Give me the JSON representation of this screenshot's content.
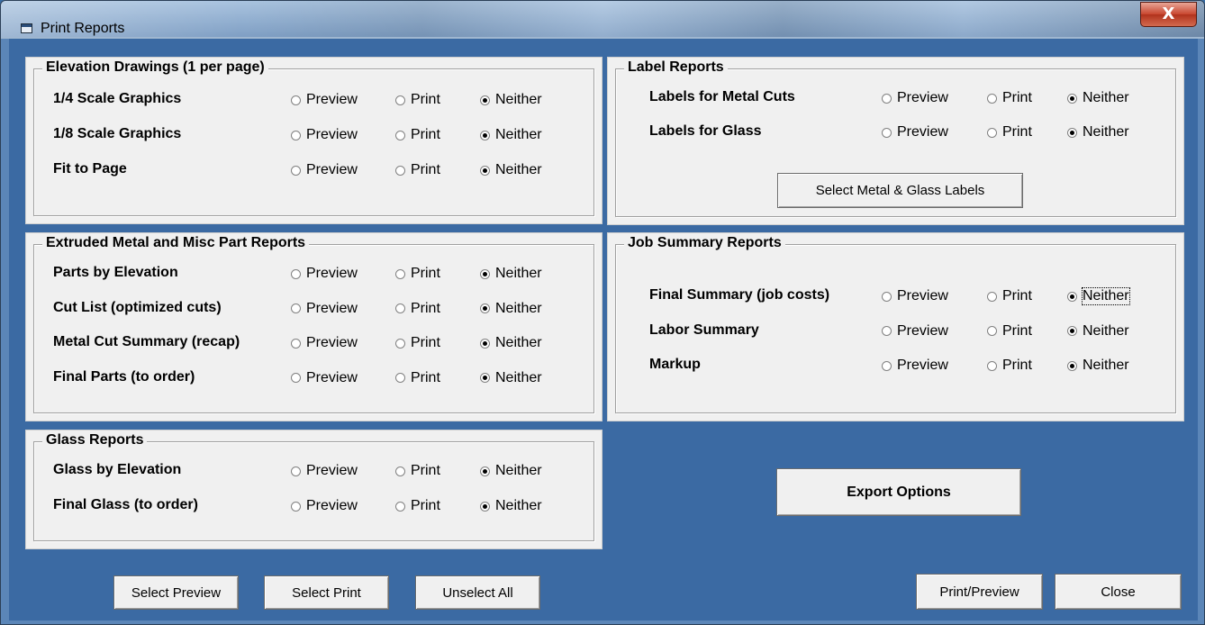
{
  "window": {
    "title": "Print Reports",
    "close_glyph": "X",
    "close_icon": "close-icon",
    "app_icon": "report-window-icon"
  },
  "options": {
    "preview": "Preview",
    "print": "Print",
    "neither": "Neither"
  },
  "groups": {
    "elevation": {
      "title": "Elevation Drawings (1 per page)",
      "rows": [
        {
          "label": "1/4 Scale Graphics",
          "selected": "neither"
        },
        {
          "label": "1/8 Scale Graphics",
          "selected": "neither"
        },
        {
          "label": "Fit to Page",
          "selected": "neither"
        }
      ]
    },
    "extruded": {
      "title": "Extruded Metal and Misc Part Reports",
      "rows": [
        {
          "label": "Parts by Elevation",
          "selected": "neither"
        },
        {
          "label": "Cut List (optimized cuts)",
          "selected": "neither"
        },
        {
          "label": "Metal Cut Summary (recap)",
          "selected": "neither"
        },
        {
          "label": "Final Parts (to order)",
          "selected": "neither"
        }
      ]
    },
    "glass": {
      "title": "Glass Reports",
      "rows": [
        {
          "label": "Glass by Elevation",
          "selected": "neither"
        },
        {
          "label": "Final Glass (to order)",
          "selected": "neither"
        }
      ]
    },
    "label": {
      "title": "Label Reports",
      "rows": [
        {
          "label": "Labels for Metal Cuts",
          "selected": "neither"
        },
        {
          "label": "Labels for Glass",
          "selected": "neither"
        }
      ],
      "button": "Select Metal & Glass Labels"
    },
    "job": {
      "title": "Job Summary Reports",
      "rows": [
        {
          "label": "Final Summary (job costs)",
          "selected": "neither"
        },
        {
          "label": "Labor Summary",
          "selected": "neither"
        },
        {
          "label": "Markup",
          "selected": "neither"
        }
      ]
    }
  },
  "buttons": {
    "export": "Export Options",
    "select_preview": "Select Preview",
    "select_print": "Select Print",
    "unselect_all": "Unselect All",
    "print_preview": "Print/Preview",
    "close": "Close"
  },
  "colors": {
    "dialog_bg": "#3b6aa3",
    "panel_bg": "#f0f0f0",
    "close_red": "#c8452e"
  }
}
